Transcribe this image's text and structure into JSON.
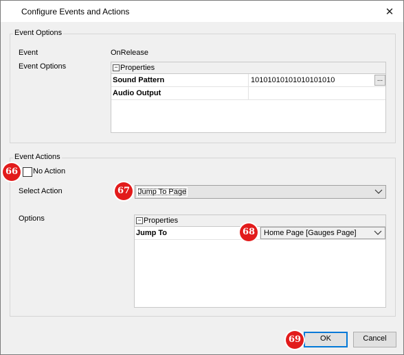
{
  "window": {
    "title": "Configure Events and Actions",
    "close_glyph": "✕"
  },
  "event_options": {
    "group_title": "Event Options",
    "event_label": "Event",
    "event_value": "OnRelease",
    "options_label": "Event Options",
    "grid": {
      "header": "Properties",
      "collapse_glyph": "−",
      "rows": [
        {
          "name": "Sound Pattern",
          "value": "10101010101010101010",
          "button": "..."
        },
        {
          "name": "Audio Output",
          "value": ""
        }
      ]
    }
  },
  "event_actions": {
    "group_title": "Event Actions",
    "no_action_label": "No Action",
    "no_action_checked": false,
    "select_action_label": "Select Action",
    "select_action_value": "Jump To Page",
    "options_label": "Options",
    "grid": {
      "header": "Properties",
      "collapse_glyph": "−",
      "rows": [
        {
          "name": "Jump To",
          "value": "Home Page [Gauges Page]"
        }
      ]
    }
  },
  "buttons": {
    "ok": "OK",
    "cancel": "Cancel"
  },
  "badges": {
    "no_action": "66",
    "select_action": "67",
    "jump_to": "68",
    "ok": "69"
  },
  "colors": {
    "badge": "#e21b1b",
    "focus_border": "#0078d7"
  }
}
